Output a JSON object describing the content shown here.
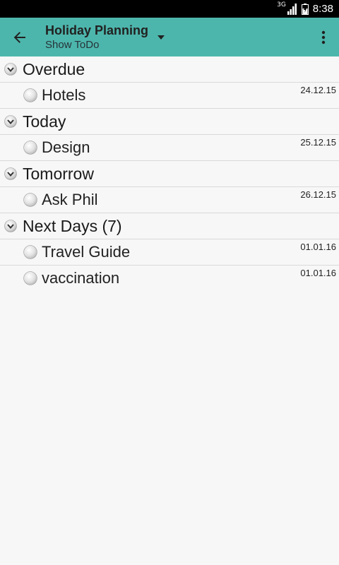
{
  "status_bar": {
    "network": "3G",
    "time": "8:38"
  },
  "toolbar": {
    "title": "Holiday Planning",
    "subtitle": "Show ToDo",
    "back_icon": "arrow-back-icon",
    "dropdown_icon": "dropdown-triangle-icon",
    "menu_icon": "more-vert-icon",
    "background": "#4db6ac"
  },
  "groups": [
    {
      "title": "Overdue",
      "tasks": [
        {
          "name": "Hotels",
          "date": "24.12.15"
        }
      ]
    },
    {
      "title": "Today",
      "tasks": [
        {
          "name": "Design",
          "date": "25.12.15"
        }
      ]
    },
    {
      "title": "Tomorrow",
      "tasks": [
        {
          "name": "Ask Phil",
          "date": "26.12.15"
        }
      ]
    },
    {
      "title": "Next Days (7)",
      "tasks": [
        {
          "name": "Travel Guide",
          "date": "01.01.16"
        },
        {
          "name": "vaccination",
          "date": "01.01.16"
        }
      ]
    }
  ]
}
